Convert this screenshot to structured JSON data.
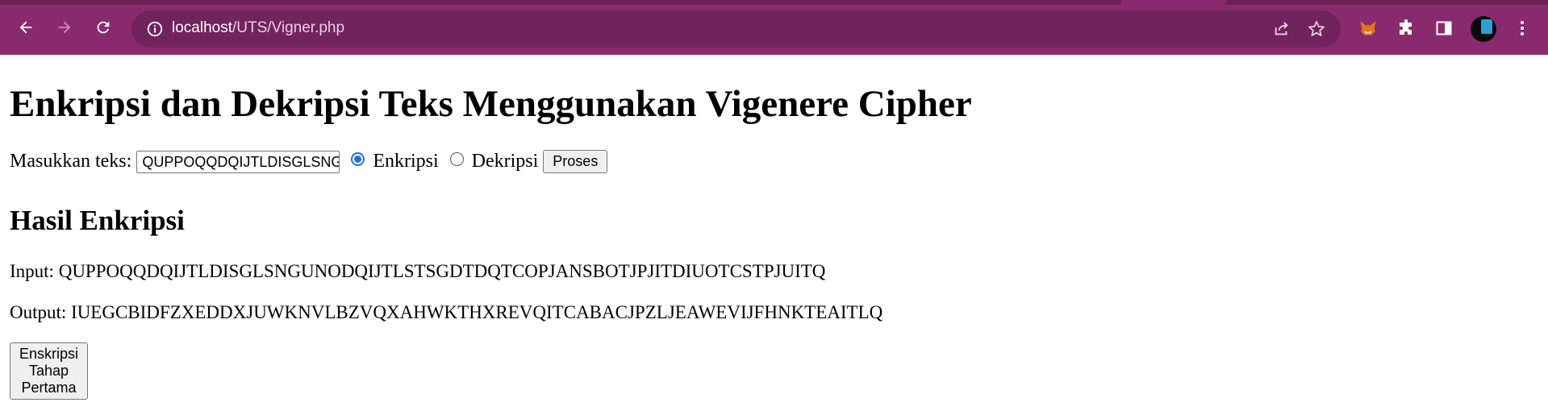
{
  "browser": {
    "url_host": "localhost",
    "url_path": "/UTS/Vigner.php"
  },
  "page": {
    "title": "Enkripsi dan Dekripsi Teks Menggunakan Vigenere Cipher",
    "form": {
      "label": "Masukkan teks:",
      "input_value": "QUPPOQQDQIJTLDISGLSNGUNODQIJTLSTSGDTDQTCOPJANSBOTJPJITDIUOTCSTPJUITQ",
      "radio_encrypt_label": "Enkripsi",
      "radio_decrypt_label": "Dekripsi",
      "selected_mode": "Enkripsi",
      "submit_label": "Proses"
    },
    "result": {
      "heading": "Hasil Enkripsi",
      "input_label": "Input:",
      "input_text": "QUPPOQQDQIJTLDISGLSNGUNODQIJTLSTSGDTDQTCOPJANSBOTJPJITDIUOTCSTPJUITQ",
      "output_label": "Output:",
      "output_text": "IUEGCBIDFZXEDDXJUWKNVLBZVQXAHWKTHXREVQITCABACJPZLJEAWEVIJFHNKTEAITLQ",
      "stage_button_label": "Enskripsi Tahap Pertama"
    }
  },
  "colors": {
    "browser_chrome": "#8a2a6e",
    "omnibox": "#71235b",
    "radio_accent": "#1a73e8"
  }
}
